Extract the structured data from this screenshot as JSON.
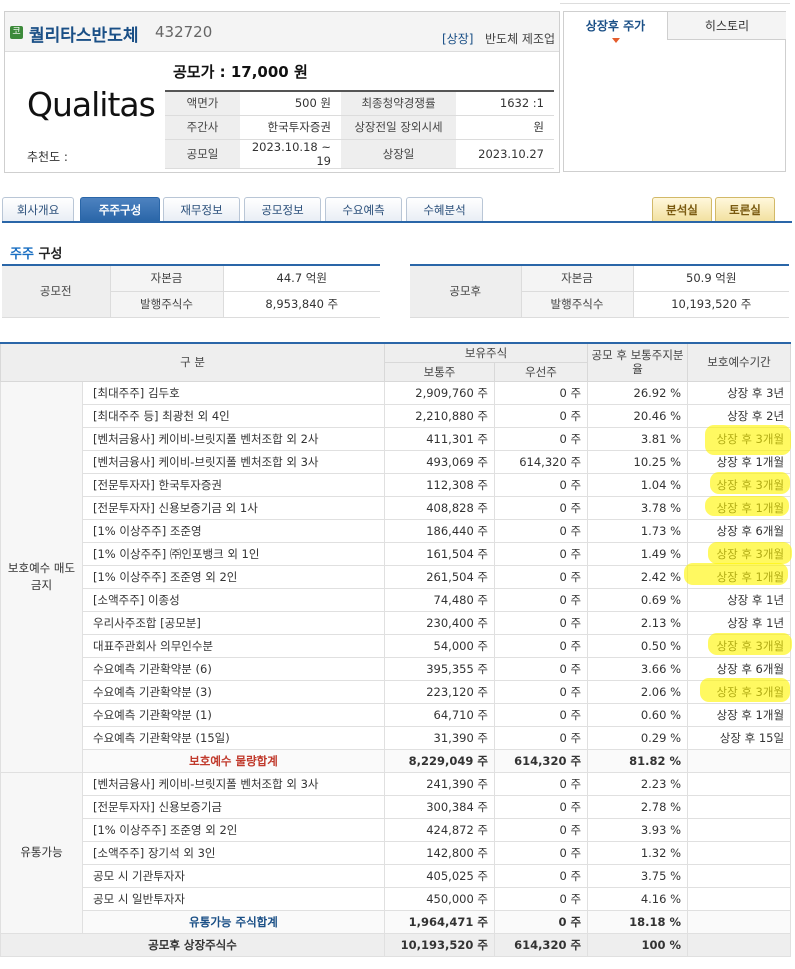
{
  "company": {
    "market_badge": "코",
    "name": "퀄리타스반도체",
    "code": "432720",
    "market_tag": "[상장]",
    "industry": "반도체 제조업",
    "logo_text": "Qualitas",
    "recommend_label": "추천도 :",
    "ipo_price_text": "공모가 : 17,000 원"
  },
  "info": {
    "rows": [
      {
        "l1": "액면가",
        "v1": "500 원",
        "l2": "최종청약경쟁률",
        "v2": "1632 :1"
      },
      {
        "l1": "주간사",
        "v1": "한국투자증권",
        "l2": "상장전일 장외시세",
        "v2": "원"
      },
      {
        "l1": "공모일",
        "v1": "2023.10.18 ~ 19",
        "l2": "상장일",
        "v2": "2023.10.27"
      }
    ]
  },
  "side_tabs": {
    "active": "상장후 주가",
    "other": "히스토리"
  },
  "nav": {
    "tabs": [
      "회사개요",
      "주주구성",
      "재무정보",
      "공모정보",
      "수요예측",
      "수혜분석"
    ],
    "right": [
      "분석실",
      "토론실"
    ]
  },
  "section": {
    "title_accent": "주주",
    "title_rest": " 구성"
  },
  "capital": {
    "before": {
      "group": "공모전",
      "capital_label": "자본금",
      "capital": "44.7 억원",
      "shares_label": "발행주식수",
      "shares": "8,953,840 주"
    },
    "after": {
      "group": "공모후",
      "capital_label": "자본금",
      "capital": "50.9 억원",
      "shares_label": "발행주식수",
      "shares": "10,193,520 주"
    }
  },
  "table": {
    "headers": {
      "category": "구    분",
      "holdings": "보유주식",
      "common": "보통주",
      "preferred": "우선주",
      "ratio": "공모 후 보통주지분율",
      "lockup": "보호예수기간"
    },
    "locked_group": "보호예수 매도금지",
    "locked_rows": [
      {
        "name": "[최대주주] 김두호",
        "common": "2,909,760 주",
        "preferred": "0 주",
        "ratio": "26.92 %",
        "lockup": "상장 후 3년"
      },
      {
        "name": "[최대주주 등] 최광천 외 4인",
        "common": "2,210,880 주",
        "preferred": "0 주",
        "ratio": "20.46 %",
        "lockup": "상장 후 2년"
      },
      {
        "name": "[벤처금융사] 케이비-브릿지폴 벤처조합 외 2사",
        "common": "411,301 주",
        "preferred": "0 주",
        "ratio": "3.81 %",
        "lockup": "상장 후 3개월"
      },
      {
        "name": "[벤처금융사] 케이비-브릿지폴 벤처조합 외 3사",
        "common": "493,069 주",
        "preferred": "614,320 주",
        "ratio": "10.25 %",
        "lockup": "상장 후 1개월"
      },
      {
        "name": "[전문투자자] 한국투자증권",
        "common": "112,308 주",
        "preferred": "0 주",
        "ratio": "1.04 %",
        "lockup": "상장 후 3개월"
      },
      {
        "name": "[전문투자자] 신용보증기금 외 1사",
        "common": "408,828 주",
        "preferred": "0 주",
        "ratio": "3.78 %",
        "lockup": "상장 후 1개월"
      },
      {
        "name": "[1% 이상주주] 조준영",
        "common": "186,440 주",
        "preferred": "0 주",
        "ratio": "1.73 %",
        "lockup": "상장 후 6개월"
      },
      {
        "name": "[1% 이상주주] ㈜인포뱅크 외 1인",
        "common": "161,504 주",
        "preferred": "0 주",
        "ratio": "1.49 %",
        "lockup": "상장 후 3개월"
      },
      {
        "name": "[1% 이상주주] 조준영 외 2인",
        "common": "261,504 주",
        "preferred": "0 주",
        "ratio": "2.42 %",
        "lockup": "상장 후 1개월"
      },
      {
        "name": "[소액주주] 이종성",
        "common": "74,480 주",
        "preferred": "0 주",
        "ratio": "0.69 %",
        "lockup": "상장 후 1년"
      },
      {
        "name": "우리사주조합 [공모분]",
        "common": "230,400 주",
        "preferred": "0 주",
        "ratio": "2.13 %",
        "lockup": "상장 후 1년"
      },
      {
        "name": "대표주관회사 의무인수분",
        "common": "54,000 주",
        "preferred": "0 주",
        "ratio": "0.50 %",
        "lockup": "상장 후 3개월"
      },
      {
        "name": "수요예측 기관확약분 (6)",
        "common": "395,355 주",
        "preferred": "0 주",
        "ratio": "3.66 %",
        "lockup": "상장 후 6개월"
      },
      {
        "name": "수요예측 기관확약분 (3)",
        "common": "223,120 주",
        "preferred": "0 주",
        "ratio": "2.06 %",
        "lockup": "상장 후 3개월"
      },
      {
        "name": "수요예측 기관확약분 (1)",
        "common": "64,710 주",
        "preferred": "0 주",
        "ratio": "0.60 %",
        "lockup": "상장 후 1개월"
      },
      {
        "name": "수요예측 기관확약분 (15일)",
        "common": "31,390 주",
        "preferred": "0 주",
        "ratio": "0.29 %",
        "lockup": "상장 후 15일"
      }
    ],
    "locked_sum": {
      "label": "보호예수 물량합계",
      "common": "8,229,049 주",
      "preferred": "614,320 주",
      "ratio": "81.82 %"
    },
    "free_group": "유통가능",
    "free_rows": [
      {
        "name": "[벤처금융사] 케이비-브릿지폴 벤처조합 외 3사",
        "common": "241,390 주",
        "preferred": "0 주",
        "ratio": "2.23 %"
      },
      {
        "name": "[전문투자자] 신용보증기금",
        "common": "300,384 주",
        "preferred": "0 주",
        "ratio": "2.78 %"
      },
      {
        "name": "[1% 이상주주] 조준영 외 2인",
        "common": "424,872 주",
        "preferred": "0 주",
        "ratio": "3.93 %"
      },
      {
        "name": "[소액주주] 장기석 외 3인",
        "common": "142,800 주",
        "preferred": "0 주",
        "ratio": "1.32 %"
      },
      {
        "name": "공모 시 기관투자자",
        "common": "405,025 주",
        "preferred": "0 주",
        "ratio": "3.75 %"
      },
      {
        "name": "공모 시 일반투자자",
        "common": "450,000 주",
        "preferred": "0 주",
        "ratio": "4.16 %"
      }
    ],
    "free_sum": {
      "label": "유통가능 주식합계",
      "common": "1,964,471 주",
      "preferred": "0 주",
      "ratio": "18.18 %"
    },
    "total": {
      "label": "공모후 상장주식수",
      "common": "10,193,520 주",
      "preferred": "614,320 주",
      "ratio": "100 %"
    }
  },
  "colors": {
    "accent_blue": "#2a66a8",
    "sum_red": "#c0392b",
    "highlight_yellow": "#fff600",
    "kosdaq_green": "#3c8a3a"
  }
}
